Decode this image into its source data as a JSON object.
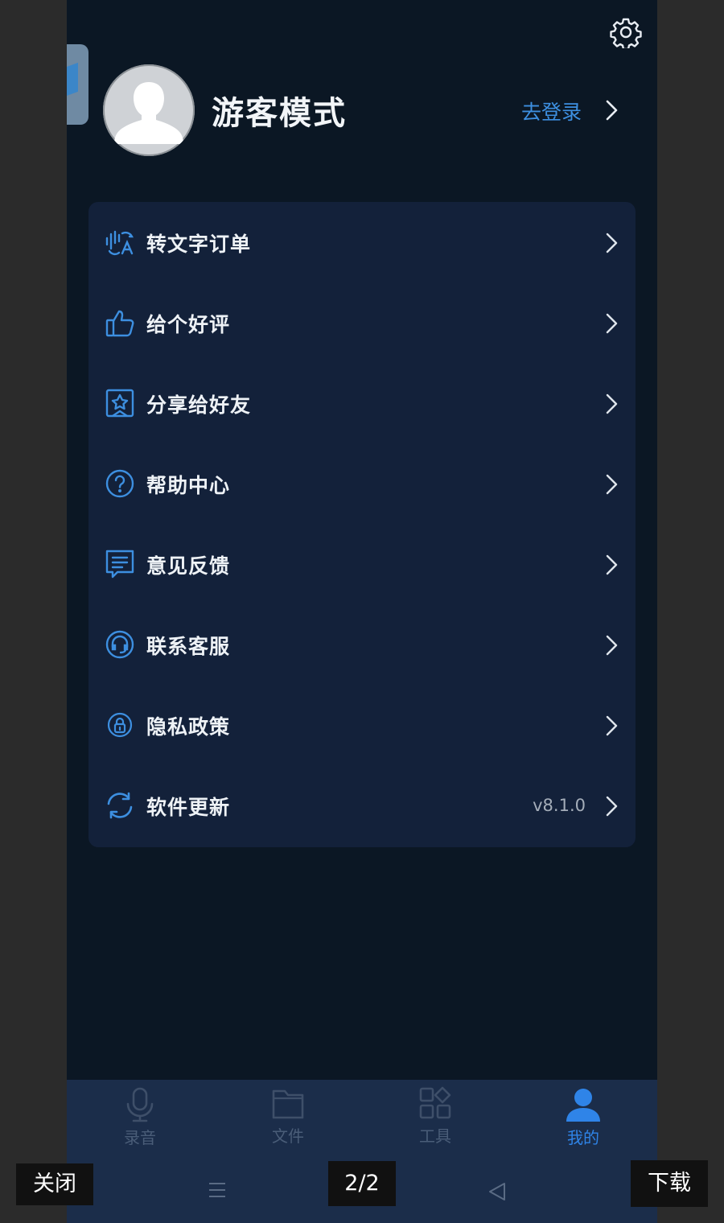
{
  "profile": {
    "username": "游客模式",
    "login_label": "去登录"
  },
  "menu": [
    {
      "icon": "speech-to-text-icon",
      "label": "转文字订单",
      "value": ""
    },
    {
      "icon": "thumbs-up-icon",
      "label": "给个好评",
      "value": ""
    },
    {
      "icon": "share-star-icon",
      "label": "分享给好友",
      "value": ""
    },
    {
      "icon": "help-circle-icon",
      "label": "帮助中心",
      "value": ""
    },
    {
      "icon": "feedback-icon",
      "label": "意见反馈",
      "value": ""
    },
    {
      "icon": "headset-icon",
      "label": "联系客服",
      "value": ""
    },
    {
      "icon": "privacy-lock-icon",
      "label": "隐私政策",
      "value": ""
    },
    {
      "icon": "refresh-icon",
      "label": "软件更新",
      "value": "v8.1.0"
    }
  ],
  "tabbar": [
    {
      "icon": "microphone-icon",
      "label": "录音",
      "active": false
    },
    {
      "icon": "folder-icon",
      "label": "文件",
      "active": false
    },
    {
      "icon": "tools-grid-icon",
      "label": "工具",
      "active": false
    },
    {
      "icon": "user-icon",
      "label": "我的",
      "active": true
    }
  ],
  "viewer": {
    "close_label": "关闭",
    "page_indicator": "2/2",
    "download_label": "下载"
  },
  "colors": {
    "accent": "#2f84e8",
    "background": "#0b1724",
    "card": "#13213a",
    "tabbar": "#1b2d4a"
  }
}
